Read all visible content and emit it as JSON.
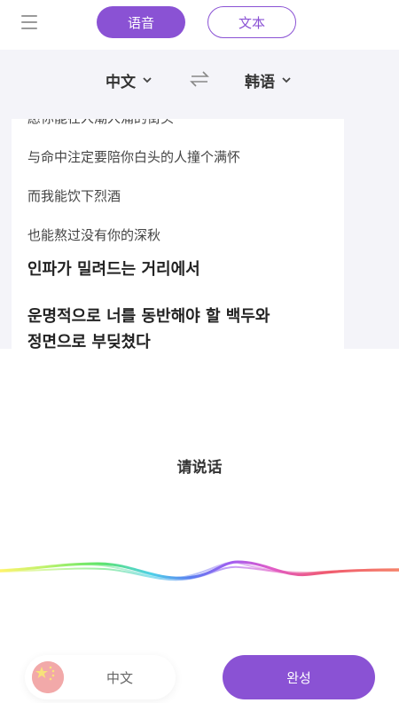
{
  "header": {
    "tabs": [
      {
        "label": "语音",
        "active": true
      },
      {
        "label": "文本",
        "active": false
      }
    ]
  },
  "language_bar": {
    "source": "中文",
    "target": "韩语"
  },
  "transcript": {
    "lines": [
      {
        "text": "愿你能在人潮人涌的街头",
        "lang": "zh"
      },
      {
        "text": "与命中注定要陪你白头的人撞个满怀",
        "lang": "zh"
      },
      {
        "text": "而我能饮下烈酒",
        "lang": "zh"
      },
      {
        "text": "也能熬过没有你的深秋",
        "lang": "zh"
      },
      {
        "text": "인파가 밀려드는 거리에서",
        "lang": "ko"
      },
      {
        "text": "운명적으로 너를 동반해야 할 백두와",
        "lang": "ko"
      },
      {
        "text": "정면으로 부딪쳤다",
        "lang": "ko"
      }
    ]
  },
  "voice": {
    "prompt": "请说话"
  },
  "footer": {
    "language_label": "中文",
    "done_label": "완성"
  },
  "colors": {
    "accent": "#8a52d4",
    "panel_bg": "#f4f4f9"
  },
  "icons": {
    "menu": "menu-icon",
    "swap": "swap-icon",
    "flag": "china-flag-icon",
    "chevron": "chevron-down-icon"
  }
}
